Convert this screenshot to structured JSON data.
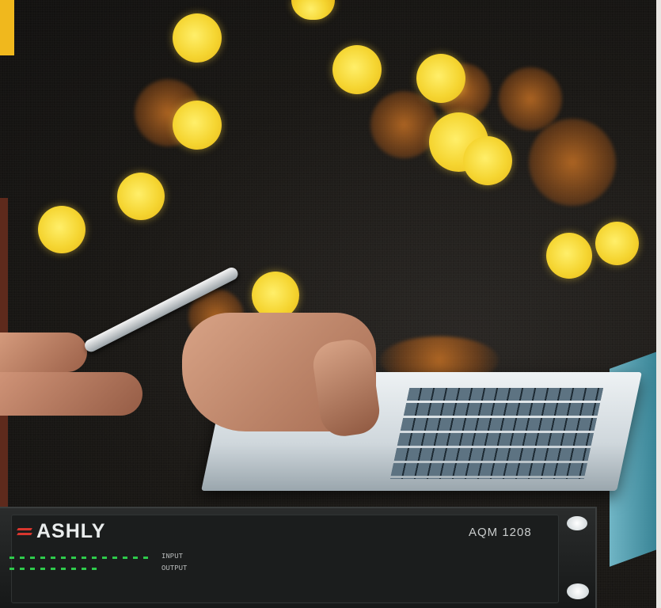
{
  "device": {
    "brand": "ASHLY",
    "model": "AQM 1208",
    "meter_labels": [
      "INPUT",
      "OUTPUT"
    ]
  },
  "colors": {
    "bokeh": "#f5d531",
    "bokeh_dim": "#c47024",
    "background": "#1a1815",
    "brand_accent": "#d8362e",
    "meter_green": "#2ecb4b"
  }
}
